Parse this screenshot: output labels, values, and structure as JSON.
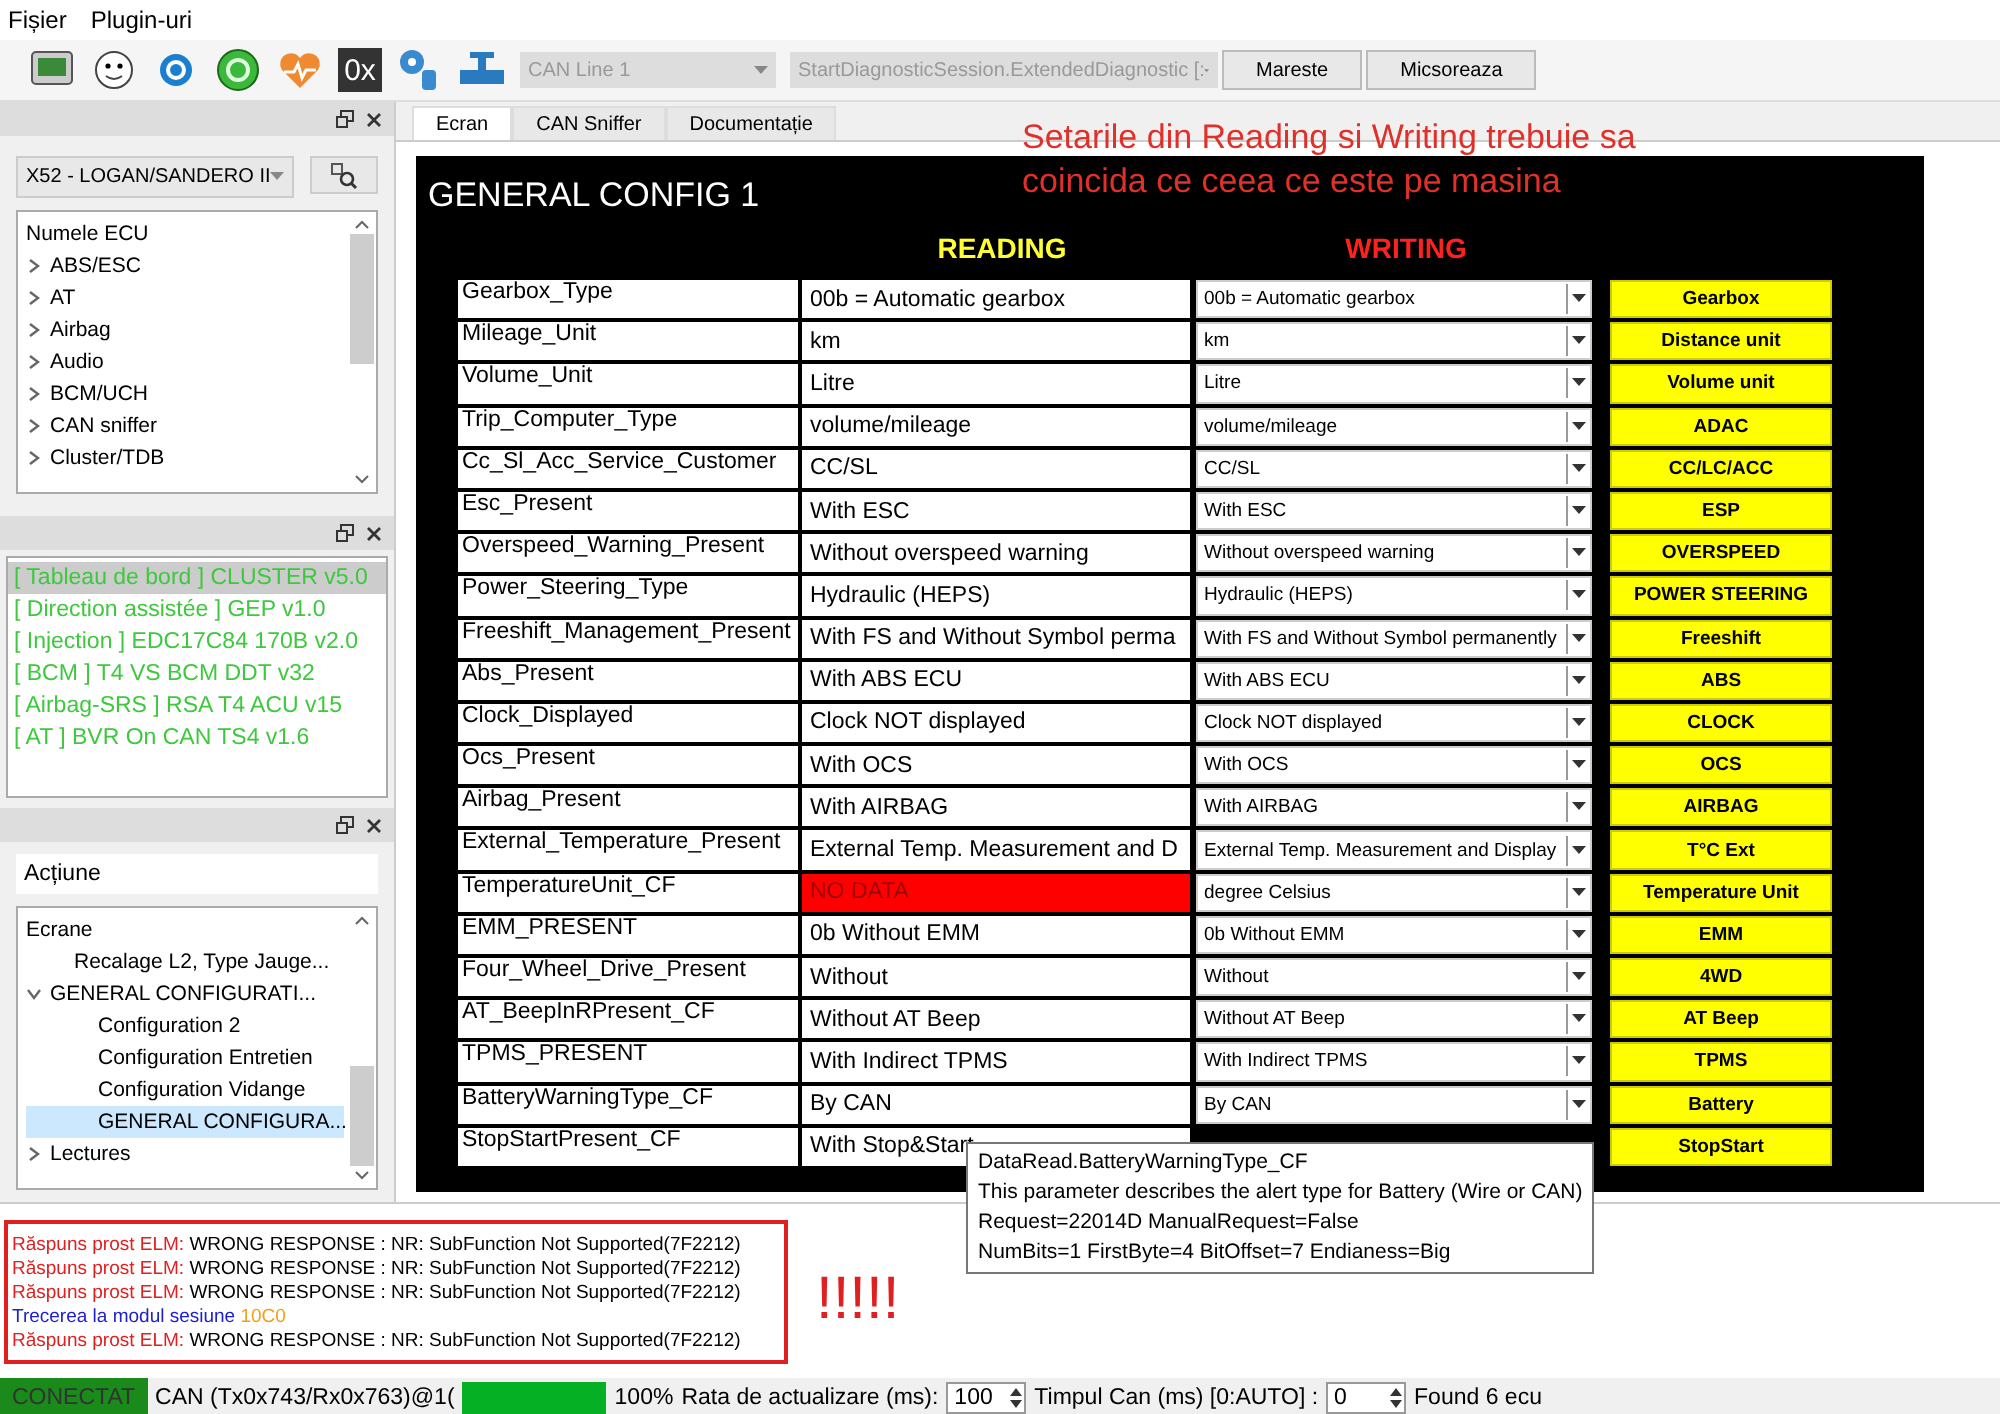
{
  "menu": [
    "Fișier",
    "Plugin-uri"
  ],
  "toolbar": {
    "hex_label": "0x",
    "can_line": "CAN Line 1",
    "session": "StartDiagnosticSession.ExtendedDiagnostic [:",
    "buttons": [
      "Mareste",
      "Micsoreaza"
    ]
  },
  "vehicle_picker": {
    "value": "X52 - LOGAN/SANDERO II"
  },
  "ecu_tree": {
    "header": "Numele ECU",
    "items": [
      {
        "label": "ABS/ESC",
        "expanded": false
      },
      {
        "label": "AT",
        "expanded": false
      },
      {
        "label": "Airbag",
        "expanded": false
      },
      {
        "label": "Audio",
        "expanded": false
      },
      {
        "label": "BCM/UCH",
        "expanded": false
      },
      {
        "label": "CAN sniffer",
        "expanded": false
      },
      {
        "label": "Cluster/TDB",
        "expanded": false
      }
    ]
  },
  "ecu_list": [
    {
      "label": "[ Tableau de bord ] CLUSTER v5.0",
      "selected": true
    },
    {
      "label": "[ Direction assistée ] GEP v1.0",
      "selected": false
    },
    {
      "label": "[ Injection ] EDC17C84 170B v2.0",
      "selected": false
    },
    {
      "label": "[ BCM ] T4 VS BCM DDT v32",
      "selected": false
    },
    {
      "label": "[ Airbag-SRS ] RSA T4 ACU v15",
      "selected": false
    },
    {
      "label": "[ AT ] BVR On CAN TS4 v1.6",
      "selected": false
    }
  ],
  "actions": {
    "filter": "Acțiune",
    "header": "Ecrane",
    "items": [
      {
        "label": "Recalage L2, Type Jauge...",
        "selected": false
      },
      {
        "label": "GENERAL CONFIGURATI...",
        "selected": false,
        "expanded": true,
        "children": [
          {
            "label": "Configuration 2",
            "selected": false
          },
          {
            "label": "Configuration Entretien",
            "selected": false
          },
          {
            "label": "Configuration Vidange",
            "selected": false
          },
          {
            "label": "GENERAL CONFIGURA...",
            "selected": true
          }
        ]
      },
      {
        "label": "Lectures",
        "selected": false,
        "expanded": false
      }
    ]
  },
  "tabs": [
    {
      "label": "Ecran",
      "selected": true
    },
    {
      "label": "CAN Sniffer",
      "selected": false
    },
    {
      "label": "Documentație",
      "selected": false
    }
  ],
  "annotation": "Setarile din Reading si Writing trebuie sa coincida ce ceea ce este pe masina",
  "screen": {
    "title": "GENERAL CONFIG 1",
    "reading_header": "READING",
    "writing_header": "WRITING",
    "rows": [
      {
        "name": "Gearbox_Type",
        "reading": "00b = Automatic gearbox",
        "error": false,
        "writing": "00b = Automatic gearbox",
        "button": "Gearbox"
      },
      {
        "name": "Mileage_Unit",
        "reading": "km",
        "error": false,
        "writing": "km",
        "button": "Distance unit"
      },
      {
        "name": "Volume_Unit",
        "reading": "Litre",
        "error": false,
        "writing": "Litre",
        "button": "Volume unit"
      },
      {
        "name": "Trip_Computer_Type",
        "reading": "volume/mileage",
        "error": false,
        "writing": "volume/mileage",
        "button": "ADAC"
      },
      {
        "name": "Cc_Sl_Acc_Service_Customer",
        "reading": "CC/SL",
        "error": false,
        "writing": "CC/SL",
        "button": "CC/LC/ACC"
      },
      {
        "name": "Esc_Present",
        "reading": "With ESC",
        "error": false,
        "writing": "With ESC",
        "button": "ESP"
      },
      {
        "name": "Overspeed_Warning_Present",
        "reading": "Without overspeed warning",
        "error": false,
        "writing": "Without overspeed warning",
        "button": "OVERSPEED"
      },
      {
        "name": "Power_Steering_Type",
        "reading": "Hydraulic (HEPS)",
        "error": false,
        "writing": "Hydraulic (HEPS)",
        "button": "POWER STEERING"
      },
      {
        "name": "Freeshift_Management_Present",
        "reading": "With FS and Without Symbol perma",
        "error": false,
        "writing": "With FS and Without Symbol permanently",
        "button": "Freeshift"
      },
      {
        "name": "Abs_Present",
        "reading": "With ABS ECU",
        "error": false,
        "writing": "With ABS ECU",
        "button": "ABS"
      },
      {
        "name": "Clock_Displayed",
        "reading": "Clock NOT displayed",
        "error": false,
        "writing": "Clock NOT displayed",
        "button": "CLOCK"
      },
      {
        "name": "Ocs_Present",
        "reading": "With OCS",
        "error": false,
        "writing": "With OCS",
        "button": "OCS"
      },
      {
        "name": "Airbag_Present",
        "reading": "With AIRBAG",
        "error": false,
        "writing": "With AIRBAG",
        "button": "AIRBAG"
      },
      {
        "name": "External_Temperature_Present",
        "reading": "External Temp. Measurement and D",
        "error": false,
        "writing": "External Temp. Measurement and Display",
        "button": "T°C Ext"
      },
      {
        "name": "TemperatureUnit_CF",
        "reading": "NO DATA",
        "error": true,
        "writing": "degree Celsius",
        "button": "Temperature Unit"
      },
      {
        "name": "EMM_PRESENT",
        "reading": "0b Without EMM",
        "error": false,
        "writing": "0b Without EMM",
        "button": "EMM"
      },
      {
        "name": "Four_Wheel_Drive_Present",
        "reading": "Without",
        "error": false,
        "writing": "Without",
        "button": "4WD"
      },
      {
        "name": "AT_BeepInRPresent_CF",
        "reading": "Without AT Beep",
        "error": false,
        "writing": "Without AT Beep",
        "button": "AT Beep"
      },
      {
        "name": "TPMS_PRESENT",
        "reading": "With Indirect TPMS",
        "error": false,
        "writing": "With Indirect TPMS",
        "button": "TPMS"
      },
      {
        "name": "BatteryWarningType_CF",
        "reading": "By CAN",
        "error": false,
        "writing": "By CAN",
        "button": "Battery"
      },
      {
        "name": "StopStartPresent_CF",
        "reading": "With Stop&Start",
        "error": false,
        "writing": "",
        "button": "StopStart"
      }
    ]
  },
  "tooltip": [
    "DataRead.BatteryWarningType_CF",
    "This parameter describes the alert type for Battery (Wire or CAN)",
    "Request=22014D ManualRequest=False",
    "NumBits=1 FirstByte=4 BitOffset=7 Endianess=Big"
  ],
  "log": [
    {
      "kind": "error",
      "label": "Răspuns prost ELM:",
      "message": "WRONG RESPONSE : NR: SubFunction Not Supported(7F2212)"
    },
    {
      "kind": "error",
      "label": "Răspuns prost ELM:",
      "message": "WRONG RESPONSE : NR: SubFunction Not Supported(7F2212)"
    },
    {
      "kind": "error",
      "label": "Răspuns prost ELM:",
      "message": "WRONG RESPONSE : NR: SubFunction Not Supported(7F2212)"
    },
    {
      "kind": "info",
      "label": "Trecerea la modul sesiune",
      "message": "10C0"
    },
    {
      "kind": "error",
      "label": "Răspuns prost ELM:",
      "message": "WRONG RESPONSE : NR: SubFunction Not Supported(7F2212)"
    }
  ],
  "exclamation": "!!!!!",
  "status_bar": {
    "connection": "CONECTAT",
    "connected": true,
    "can": "CAN (Tx0x743/Rx0x763)@1(",
    "progress": {
      "level": 1,
      "reading": "100%"
    },
    "refresh_label": "Rata de actualizare (ms):",
    "refresh_value": "100",
    "can_time_label": "Timpul Can (ms) [0:AUTO] :",
    "can_time_value": "0",
    "found": "Found 6 ecu"
  }
}
